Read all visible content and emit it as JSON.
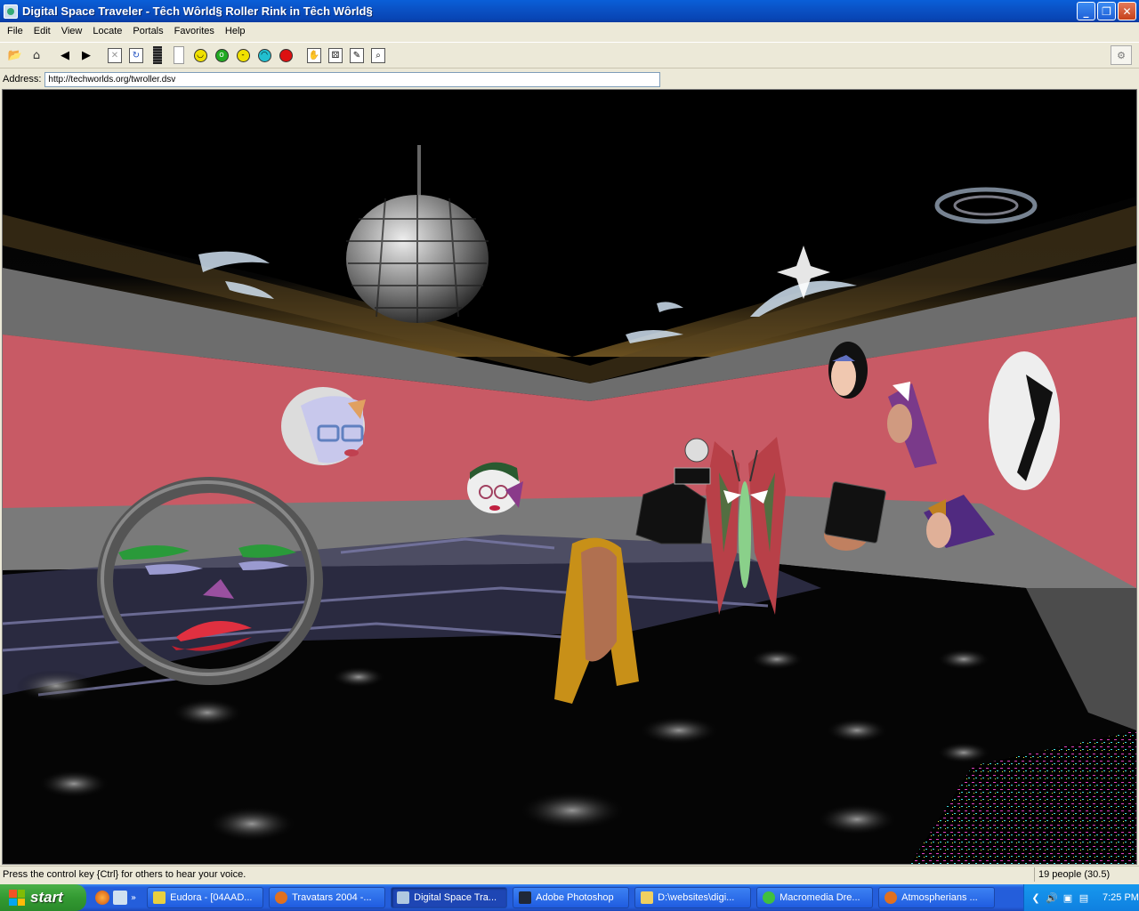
{
  "window": {
    "title": "Digital Space Traveler - Têch Wôrld§ Roller Rink in Têch Wôrld§",
    "controls": {
      "minimize": "_",
      "maximize": "❐",
      "close": "✕"
    }
  },
  "menu": {
    "items": [
      "File",
      "Edit",
      "View",
      "Locate",
      "Portals",
      "Favorites",
      "Help"
    ]
  },
  "toolbar": {
    "buttons": [
      "open-folder-icon",
      "home-icon",
      "back-arrow-icon",
      "forward-arrow-icon",
      "stop-icon",
      "refresh-icon",
      "volume-meter-icon",
      "blank-icon",
      "happy-face-icon",
      "surprised-face-icon",
      "neutral-face-icon",
      "sad-face-icon",
      "red-stop-face-icon",
      "wave-gesture-icon",
      "dice-icon",
      "notes-icon",
      "search-people-icon",
      "options-icon"
    ],
    "emotion_colors": {
      "happy": "#f0e000",
      "surprised": "#22aa22",
      "neutral": "#f0e000",
      "sad": "#22c0d0",
      "stop": "#dd1111"
    }
  },
  "address": {
    "label": "Address:",
    "value": "http://techworlds.org/twroller.dsv"
  },
  "scene": {
    "description_colors": {
      "wall": "#c85a65",
      "ceiling": "#000000",
      "floor": "#050505",
      "rail": "#7a7a7a"
    }
  },
  "status": {
    "message": "Press the control key {Ctrl} for others to hear your voice.",
    "people": "19 people (30.5)"
  },
  "taskbar": {
    "start_label": "start",
    "tasks": [
      {
        "label": "Eudora - [04AAD...",
        "icon_color": "#e8d040"
      },
      {
        "label": "Travatars 2004 -...",
        "icon_color": "#e07020"
      },
      {
        "label": "Digital Space Tra...",
        "icon_color": "#b0c8e0",
        "active": true
      },
      {
        "label": "Adobe Photoshop",
        "icon_color": "#202838"
      },
      {
        "label": "D:\\websites\\digi...",
        "icon_color": "#f0d060"
      },
      {
        "label": "Macromedia Dre...",
        "icon_color": "#40c040"
      },
      {
        "label": "Atmospherians ...",
        "icon_color": "#e07020"
      }
    ],
    "clock": "7:25 PM"
  }
}
